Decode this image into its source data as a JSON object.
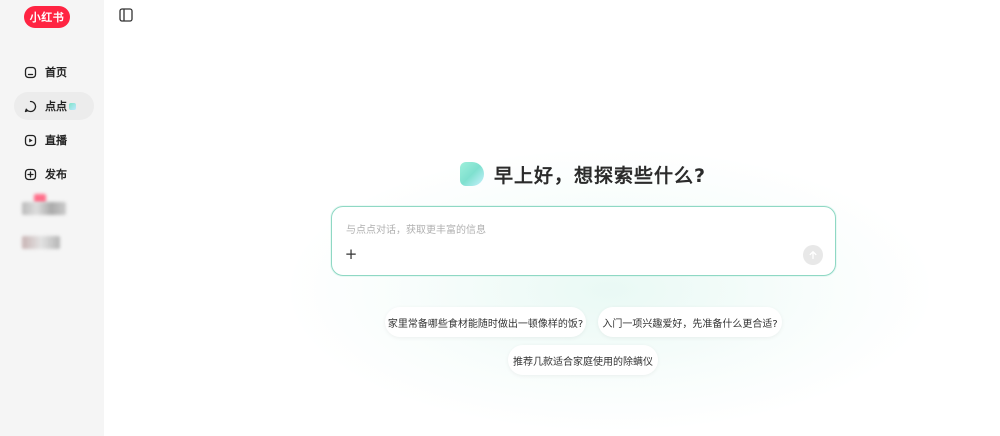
{
  "brand": {
    "logo_text": "小红书",
    "color": "#ff2442"
  },
  "sidebar": {
    "items": [
      {
        "label": "首页",
        "icon": "home-icon"
      },
      {
        "label": "点点",
        "icon": "chat-bubble-icon",
        "active": true
      },
      {
        "label": "直播",
        "icon": "live-icon"
      },
      {
        "label": "发布",
        "icon": "add-square-icon"
      }
    ]
  },
  "main": {
    "greeting": "早上好，想探索些什么?",
    "input": {
      "placeholder": "与点点对话，获取更丰富的信息"
    },
    "suggestions": [
      "家里常备哪些食材能随时做出一顿像样的饭?",
      "入门一项兴趣爱好，先准备什么更合适?",
      "推荐几款适合家庭使用的除螨仪"
    ]
  },
  "colors": {
    "accent": "#8fd8c4",
    "sidebar_bg": "#f5f5f5"
  }
}
